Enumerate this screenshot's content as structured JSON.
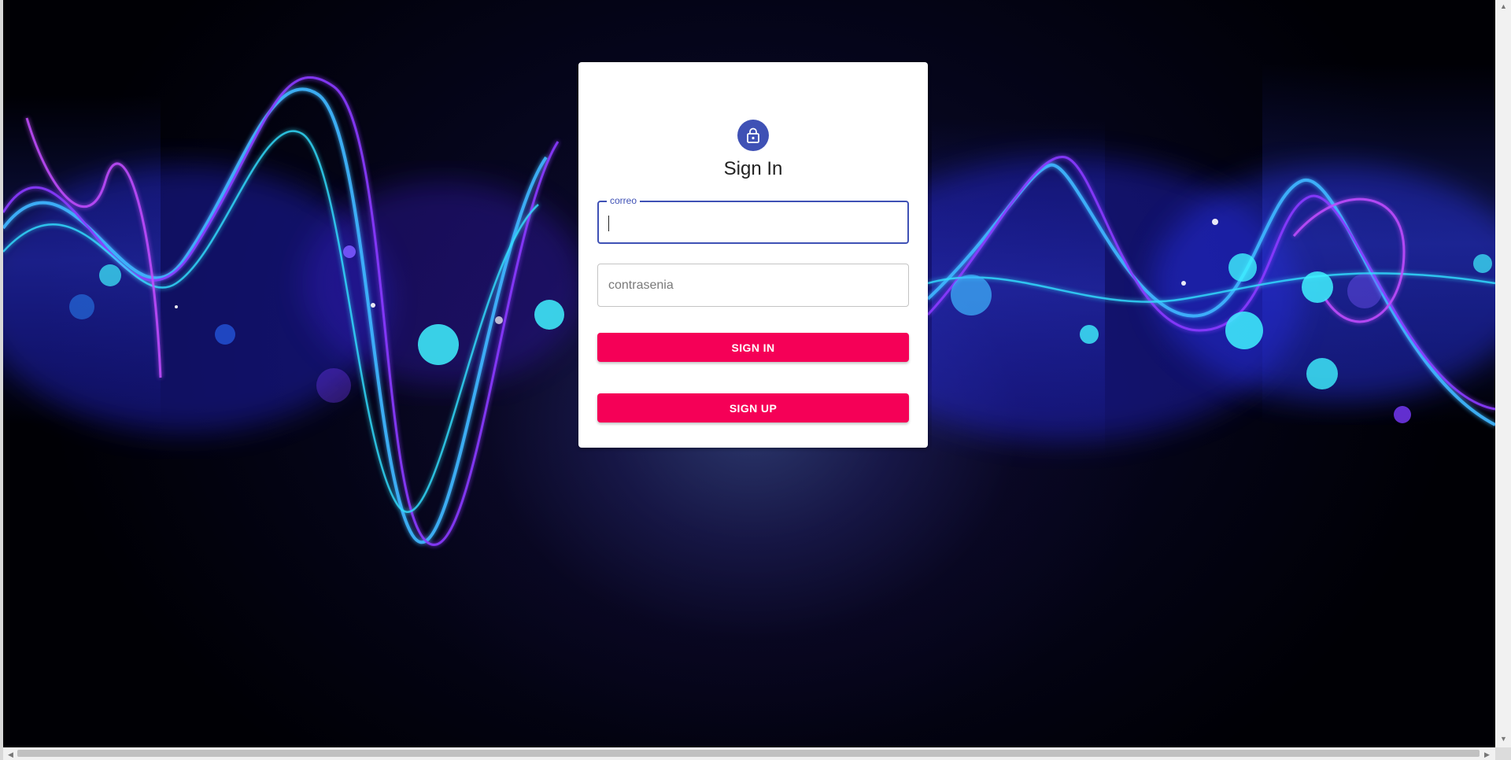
{
  "login": {
    "title": "Sign In",
    "lock_icon": "lock-icon",
    "email_label": "correo",
    "email_value": "",
    "password_placeholder": "contrasenia",
    "signin_label": "SIGN IN",
    "signup_label": "SIGN UP"
  },
  "colors": {
    "primary": "#3f51b5",
    "accent": "#f50057",
    "card": "#ffffff"
  },
  "background": {
    "image": "abstract-neon-wave-background"
  }
}
